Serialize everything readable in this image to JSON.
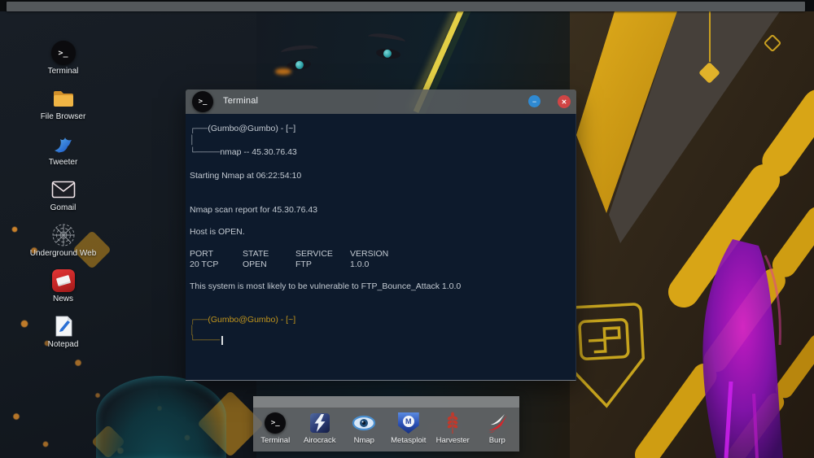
{
  "window": {
    "title": "Terminal",
    "terminal_glyph": ">_",
    "controls": {
      "minimize_glyph": "−",
      "close_glyph": "✕"
    }
  },
  "terminal": {
    "prompt_top": {
      "l1_branch": "┌──",
      "l1_user": "(Gumbo@Gumbo) - [~]",
      "l2_pipe": "│",
      "l3_branch": "└────",
      "l3_command": "nmap -- 45.30.76.43"
    },
    "starting": "Starting Nmap at 06:22:54:10",
    "report": "Nmap scan report for 45.30.76.43",
    "host_status": "Host is OPEN.",
    "table": {
      "headers": [
        "PORT",
        "STATE",
        "SERVICE",
        "VERSION"
      ],
      "row": [
        "20 TCP",
        "OPEN",
        "FTP",
        "1.0.0"
      ]
    },
    "vulnerability": "This system is most likely to be vulnerable to FTP_Bounce_Attack 1.0.0",
    "prompt_bottom": {
      "l1_branch": "┌──",
      "l1_user": "(Gumbo@Gumbo) - [~]",
      "l2_pipe": "│",
      "l3_branch": "└────"
    }
  },
  "desktop_icons": [
    {
      "label": "Terminal"
    },
    {
      "label": "File Browser"
    },
    {
      "label": "Tweeter"
    },
    {
      "label": "Gomail"
    },
    {
      "label": "Underground Web"
    },
    {
      "label": "News"
    },
    {
      "label": "Notepad"
    }
  ],
  "dock": [
    {
      "label": "Terminal"
    },
    {
      "label": "Airocrack"
    },
    {
      "label": "Nmap"
    },
    {
      "label": "Metasploit",
      "letter": "M"
    },
    {
      "label": "Harvester"
    },
    {
      "label": "Burp"
    }
  ],
  "colors": {
    "terminal_bg": "#0d1a2c",
    "titlebar_gray": "#585c5f",
    "minimize_blue": "#2f8ad2",
    "close_red": "#d04545",
    "prompt_yellow": "#c1951c",
    "accent_gold": "#d8a516"
  }
}
